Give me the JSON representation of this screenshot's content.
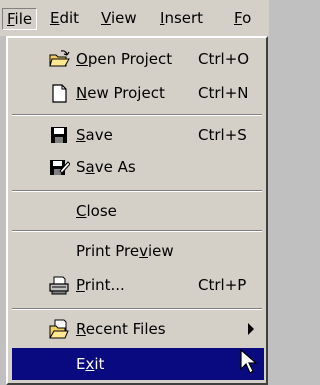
{
  "menubar": {
    "items": [
      {
        "label": "File",
        "ul": "F",
        "rest": "ile"
      },
      {
        "label": "Edit",
        "ul": "E",
        "rest": "dit"
      },
      {
        "label": "View",
        "ul": "V",
        "rest": "iew"
      },
      {
        "label": "Insert",
        "ul": "I",
        "rest": "nsert"
      },
      {
        "label": "Fo",
        "ul": "F",
        "rest": "o"
      }
    ]
  },
  "menu": {
    "open_project": {
      "pre": "",
      "ul": "O",
      "post": "pen Project",
      "shortcut": "Ctrl+O",
      "icon": "open-folder-icon"
    },
    "new_project": {
      "pre": "",
      "ul": "N",
      "post": "ew Project",
      "shortcut": "Ctrl+N",
      "icon": "new-document-icon"
    },
    "save": {
      "pre": "",
      "ul": "S",
      "post": "ave",
      "shortcut": "Ctrl+S",
      "icon": "save-disk-icon"
    },
    "save_as": {
      "pre": "S",
      "ul": "a",
      "post": "ve As",
      "icon": "save-as-icon"
    },
    "close": {
      "pre": "",
      "ul": "C",
      "post": "lose"
    },
    "print_preview": {
      "pre": "Print Pre",
      "ul": "v",
      "post": "iew"
    },
    "print": {
      "pre": "",
      "ul": "P",
      "post": "rint...",
      "shortcut": "Ctrl+P",
      "icon": "printer-icon"
    },
    "recent_files": {
      "pre": "",
      "ul": "R",
      "post": "ecent Files",
      "icon": "recent-files-icon"
    },
    "exit": {
      "pre": "E",
      "ul": "x",
      "post": "it"
    }
  },
  "colors": {
    "highlight": "#0a0a80",
    "menu_bg": "#d4d0c8"
  }
}
